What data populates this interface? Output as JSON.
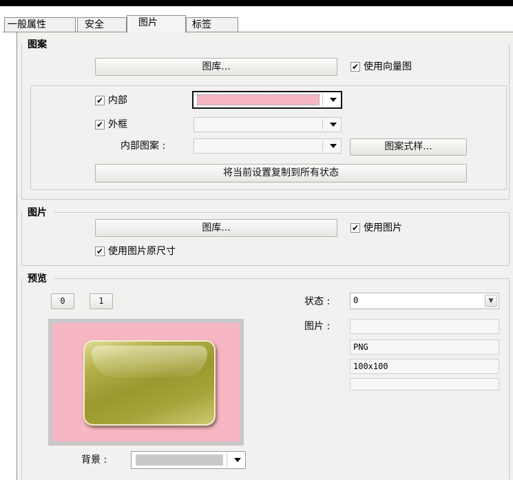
{
  "tabs": [
    {
      "label": "一般属性"
    },
    {
      "label": "安全"
    },
    {
      "label": "图片"
    },
    {
      "label": "标签"
    }
  ],
  "pattern": {
    "title": "图案",
    "gallery_button": "图库...",
    "use_vector_label": "使用向量图",
    "use_vector_checked": true,
    "inner_label": "内部",
    "inner_checked": true,
    "inner_color": "#f7b6c3",
    "frame_label": "外框",
    "frame_checked": true,
    "inner_pattern_label": "内部图案 :",
    "pattern_style_button": "图案式样...",
    "copy_button": "将当前设置复制到所有状态"
  },
  "picture": {
    "title": "图片",
    "gallery_button": "图库...",
    "use_picture_label": "使用图片",
    "use_picture_checked": true,
    "original_size_label": "使用图片原尺寸",
    "original_size_checked": true
  },
  "preview": {
    "title": "预览",
    "state_buttons": [
      "0",
      "1"
    ],
    "state_label": "状态 :",
    "state_value": "0",
    "image_label": "图片 :",
    "image_name": "",
    "image_format": "PNG",
    "image_size": "100x100",
    "image_extra": "",
    "background_label": "背景 :",
    "preview_bg_color": "#f7b6c3",
    "button_color": "#a6a33a"
  },
  "check_mark": "✔"
}
